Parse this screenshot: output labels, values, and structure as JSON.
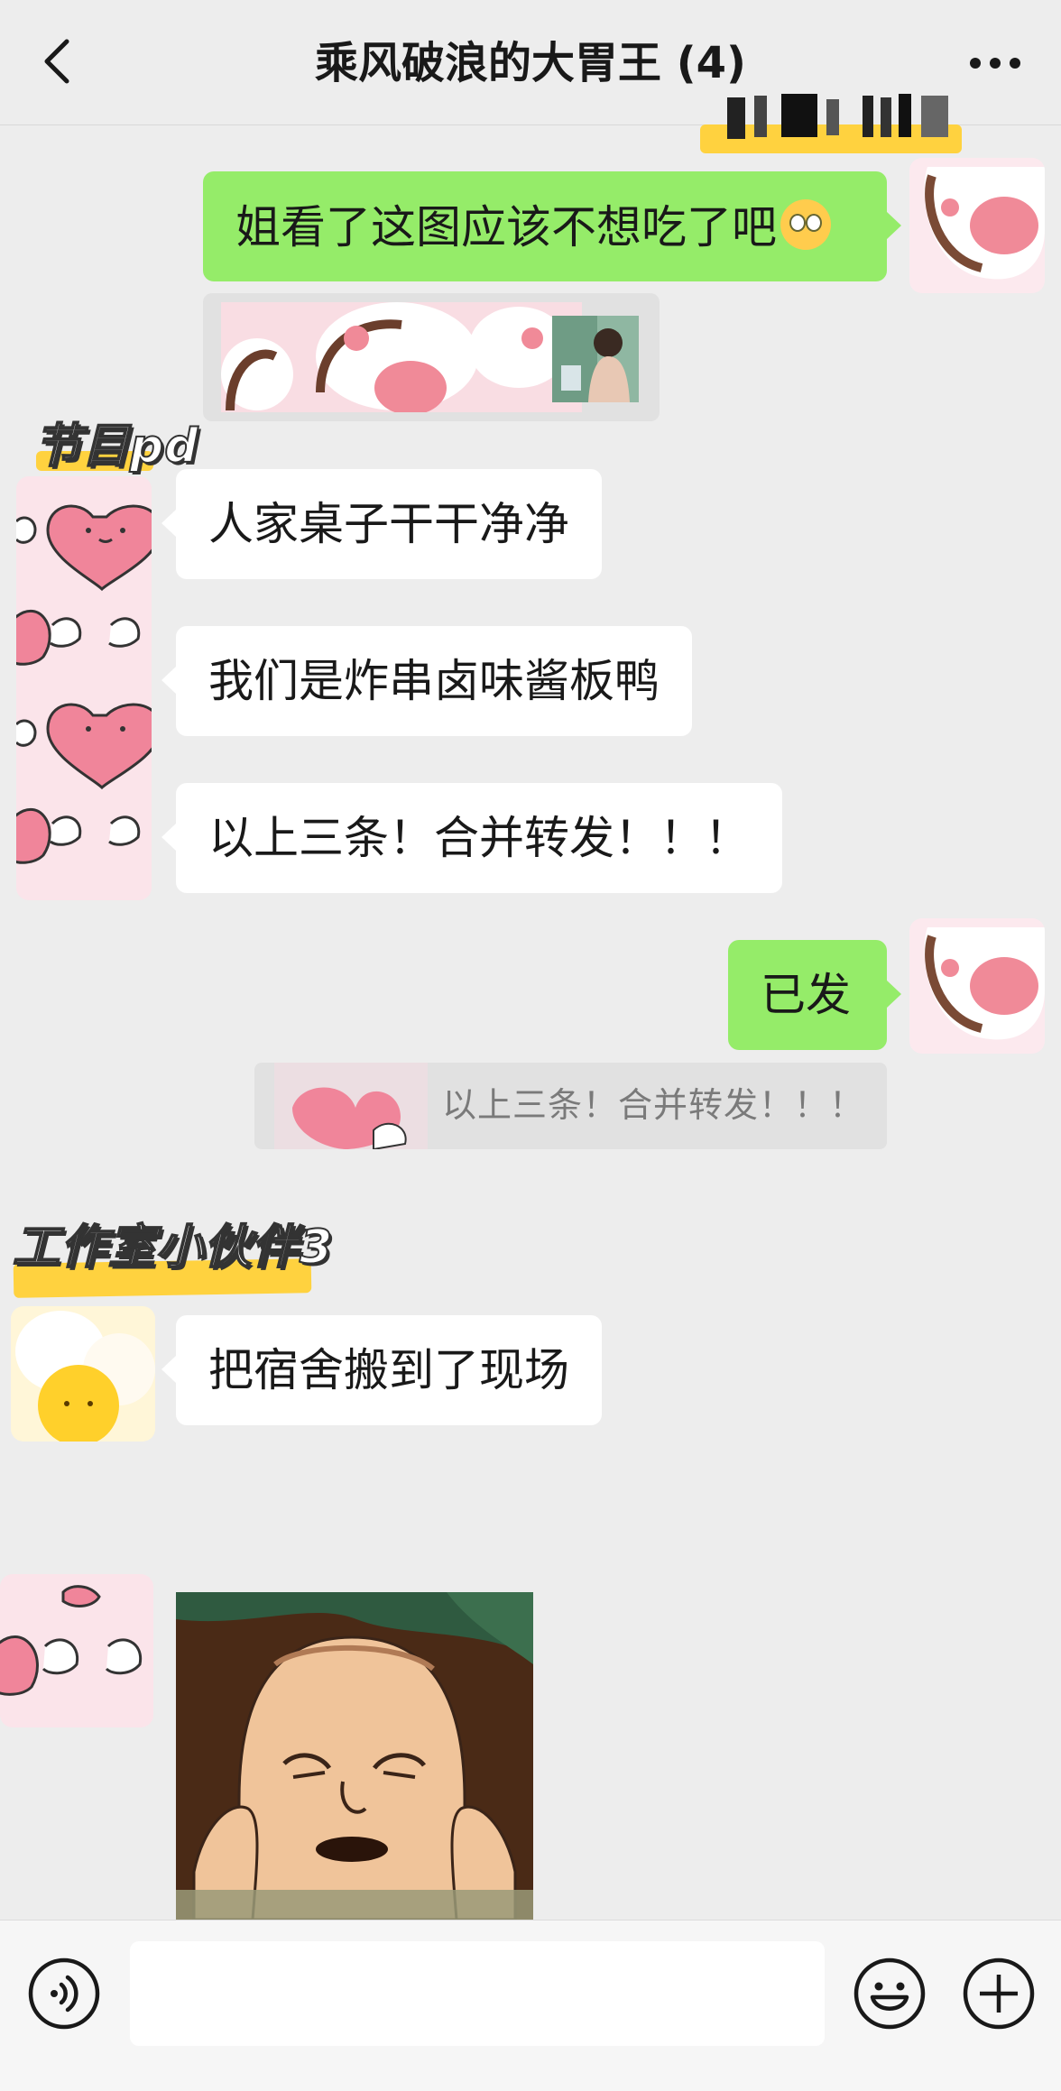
{
  "header": {
    "title": "乘风破浪的大胃王 (4)",
    "back_icon": "chevron-left-icon",
    "more_icon": "ellipsis-icon"
  },
  "messages": {
    "m1": {
      "text": "姐看了这图应该不想吃了吧",
      "emoji": "flushed-face-emoji"
    },
    "tag1": "节目pd",
    "m2": "人家桌子干干净净",
    "m3": "我们是炸串卤味酱板鸭",
    "m4": "以上三条！合并转发！！！",
    "m5": "已发",
    "quote": "以上三条！合并转发！！！",
    "tag2": "工作室小伙伴3",
    "m6": "把宿舍搬到了现场"
  },
  "input_bar": {
    "voice_icon": "voice-icon",
    "emoji_icon": "emoji-icon",
    "plus_icon": "plus-icon",
    "value": ""
  },
  "colors": {
    "background": "#ededed",
    "outgoing_bubble": "#95ec69",
    "incoming_bubble": "#ffffff",
    "tag_highlight": "#ffd23f"
  }
}
